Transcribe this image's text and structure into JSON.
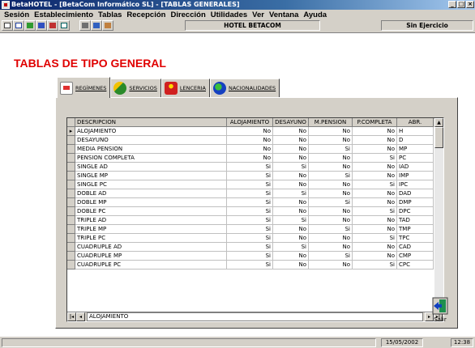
{
  "window": {
    "title": "BetaHOTEL - [BetaCom Informático SL] - [TABLAS GENERALES]",
    "controls": [
      "_",
      "□",
      "×"
    ]
  },
  "menu": [
    "Sesión",
    "Establecimiento",
    "Tablas",
    "Recepción",
    "Dirección",
    "Utilidades",
    "Ver",
    "Ventana",
    "Ayuda"
  ],
  "toolbar": {
    "hotel": "HOTEL BETACOM",
    "ejercicio": "Sin Ejercicio",
    "icons": [
      "new-icon",
      "edit-icon",
      "check-icon",
      "plane-icon",
      "card-icon",
      "layout-icon",
      "print-icon",
      "users-icon",
      "user-icon"
    ]
  },
  "page": {
    "title": "TABLAS DE TIPO GENERAL"
  },
  "tabs": [
    {
      "label": "REGÍMENES",
      "icon": "beds-icon",
      "active": true
    },
    {
      "label": "SERVICIOS",
      "icon": "services-icon",
      "active": false
    },
    {
      "label": "LENCERIA",
      "icon": "laundry-icon",
      "active": false
    },
    {
      "label": "NACIONALIDADES",
      "icon": "globe-icon",
      "active": false
    }
  ],
  "grid": {
    "columns": [
      "DESCRIPCION",
      "ALOJAMIENTO",
      "DESAYUNO",
      "M.PENSION",
      "P.COMPLETA",
      "ABR."
    ],
    "current_row_marker": "▸",
    "rows": [
      [
        "ALOJAMIENTO",
        "No",
        "No",
        "No",
        "No",
        "H"
      ],
      [
        "DESAYUNO",
        "No",
        "No",
        "No",
        "No",
        "D"
      ],
      [
        "MEDIA PENSION",
        "No",
        "No",
        "Si",
        "No",
        "MP"
      ],
      [
        "PENSION COMPLETA",
        "No",
        "No",
        "No",
        "Si",
        "PC"
      ],
      [
        "SINGLE AD",
        "Si",
        "Si",
        "No",
        "No",
        "IAD"
      ],
      [
        "SINGLE MP",
        "Si",
        "No",
        "Si",
        "No",
        "IMP"
      ],
      [
        "SINGLE PC",
        "Si",
        "No",
        "No",
        "Si",
        "IPC"
      ],
      [
        "DOBLE AD",
        "Si",
        "Si",
        "No",
        "No",
        "DAD"
      ],
      [
        "DOBLE MP",
        "Si",
        "No",
        "Si",
        "No",
        "DMP"
      ],
      [
        "DOBLE PC",
        "Si",
        "No",
        "No",
        "Si",
        "DPC"
      ],
      [
        "TRIPLE AD",
        "Si",
        "Si",
        "No",
        "No",
        "TAD"
      ],
      [
        "TRIPLE MP",
        "Si",
        "No",
        "Si",
        "No",
        "TMP"
      ],
      [
        "TRIPLE PC",
        "Si",
        "No",
        "No",
        "Si",
        "TPC"
      ],
      [
        "CUADRUPLE AD",
        "Si",
        "Si",
        "No",
        "No",
        "CAD"
      ],
      [
        "CUADRUPLE MP",
        "Si",
        "No",
        "Si",
        "No",
        "CMP"
      ],
      [
        "CUADRUPLE PC",
        "Si",
        "No",
        "No",
        "Si",
        "CPC"
      ]
    ],
    "nav_value": "ALOJAMIENTO"
  },
  "exit_button": {
    "label": "Salir"
  },
  "status": {
    "date": "15/05/2002",
    "time": "12:38"
  },
  "colors": {
    "title_red": "#e00000",
    "titlebar": "#0a246a",
    "face": "#d4d0c8"
  }
}
